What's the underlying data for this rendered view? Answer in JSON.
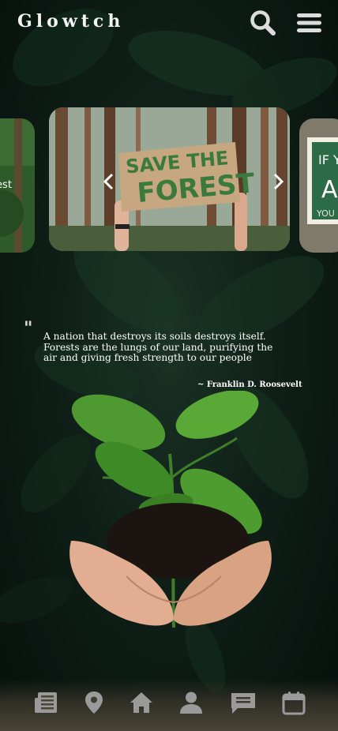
{
  "header": {
    "brand": "Glowtch",
    "search_icon": "search-icon",
    "menu_icon": "hamburger-menu-icon"
  },
  "carousel": {
    "main_slide_sign_text": [
      "SAVE THE",
      "FOREST"
    ],
    "left_slide_text": "rest",
    "right_slide_text": [
      "IF Y",
      "A",
      "YOU C"
    ],
    "prev_icon": "chevron-left-icon",
    "next_icon": "chevron-right-icon"
  },
  "quote": {
    "mark": "\"",
    "text": "A nation that destroys its soils destroys itself. Forests are the lungs of our land, purifying the air and giving fresh strength to our people",
    "author": "~ Franklin D. Roosevelt"
  },
  "nav": {
    "items": [
      {
        "name": "news",
        "icon": "newspaper-icon"
      },
      {
        "name": "location",
        "icon": "map-pin-icon"
      },
      {
        "name": "home",
        "icon": "home-icon"
      },
      {
        "name": "profile",
        "icon": "person-icon"
      },
      {
        "name": "messages",
        "icon": "chat-icon"
      },
      {
        "name": "calendar",
        "icon": "calendar-icon"
      }
    ]
  },
  "colors": {
    "brand_text": "#f2f2f2",
    "leaf_dark": "#163222",
    "icon_grey": "#9a9a9a",
    "nav_bar": "#4a4536"
  }
}
